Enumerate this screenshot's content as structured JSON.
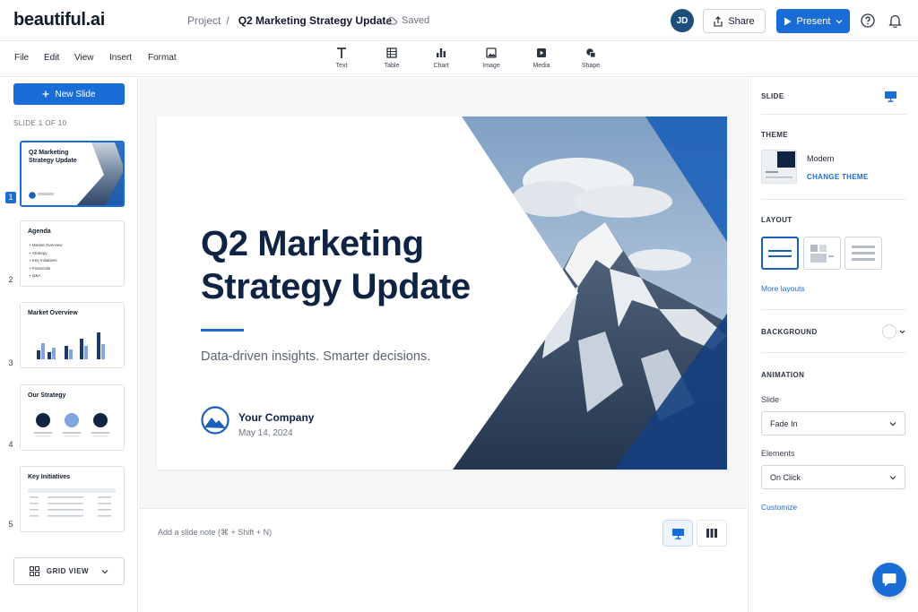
{
  "app": {
    "logo": "beautiful.ai"
  },
  "breadcrumb": {
    "project": "Project",
    "separator": "/",
    "document": "Q2 Marketing Strategy Update",
    "status": "Saved"
  },
  "header": {
    "avatar_initials": "JD",
    "share_label": "Share",
    "present_label": "Present"
  },
  "menu": [
    "File",
    "Edit",
    "View",
    "Insert",
    "Format"
  ],
  "tools": [
    {
      "label": "Text",
      "icon": "text-icon"
    },
    {
      "label": "Table",
      "icon": "table-icon"
    },
    {
      "label": "Chart",
      "icon": "chart-icon"
    },
    {
      "label": "Image",
      "icon": "image-icon"
    },
    {
      "label": "Media",
      "icon": "media-icon"
    },
    {
      "label": "Shape",
      "icon": "shape-icon"
    }
  ],
  "sidebar": {
    "new_slide_label": "New Slide",
    "slide_count": "SLIDE 1 OF 10",
    "grid_view_label": "GRID VIEW",
    "slides": [
      {
        "number": "1",
        "title": "Q2 Marketing Strategy Update"
      },
      {
        "number": "2",
        "title": "Agenda",
        "items": [
          "Market Overview",
          "Strategy",
          "Key Initiatives",
          "Financials",
          "Q&A"
        ]
      },
      {
        "number": "3",
        "title": "Market Overview"
      },
      {
        "number": "4",
        "title": "Our Strategy"
      },
      {
        "number": "5",
        "title": "Key Initiatives"
      }
    ]
  },
  "slide": {
    "title_line1": "Q2 Marketing",
    "title_line2": "Strategy Update",
    "subtitle": "Data-driven insights. Smarter decisions.",
    "company": "Your Company",
    "date": "May 14, 2024"
  },
  "notes": {
    "placeholder": "Add a slide note (⌘ + Shift + N)"
  },
  "panel": {
    "slide_heading": "SLIDE",
    "theme_heading": "THEME",
    "theme_name": "Modern",
    "change_theme": "CHANGE THEME",
    "layout_heading": "LAYOUT",
    "more_layouts": "More layouts",
    "background_heading": "BACKGROUND",
    "animation_heading": "ANIMATION",
    "slide_anim_label": "Slide",
    "slide_anim_value": "Fade In",
    "elements_label": "Elements",
    "elements_value": "On Click",
    "customize": "Customize"
  },
  "colors": {
    "accent": "#1a6cd6",
    "navy": "#0f2344"
  }
}
